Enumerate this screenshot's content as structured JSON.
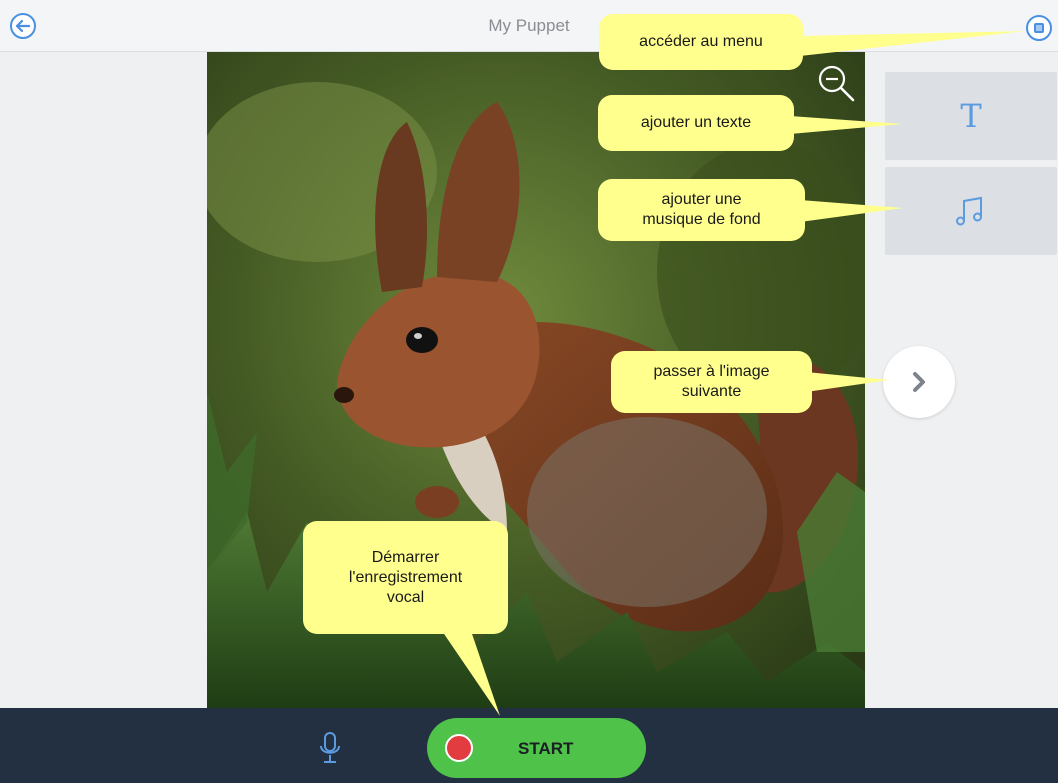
{
  "header": {
    "title": "My Puppet",
    "back_icon": "arrow-left-icon",
    "menu_icon": "menu-icon"
  },
  "canvas": {
    "image": "squirrel-photo",
    "zoom_icon": "zoom-out-icon"
  },
  "tools": {
    "text_icon": "T",
    "music_icon": "music-note-icon",
    "next_icon": "chevron-right-icon"
  },
  "bottom_bar": {
    "mic_icon": "microphone-icon",
    "start_label": "START",
    "record_icon": "record-dot-icon"
  },
  "callouts": {
    "menu": "accéder au menu",
    "text": "ajouter un texte",
    "music": "ajouter une\nmusique de fond",
    "next": "passer à l'image\nsuivante",
    "record": "Démarrer\nl'enregistrement\nvocal"
  },
  "colors": {
    "accent_blue": "#4a90e2",
    "start_green": "#4fc24a",
    "record_red": "#e23b40",
    "bottom_bar": "#233041",
    "callout_yellow": "#ffff8e"
  }
}
